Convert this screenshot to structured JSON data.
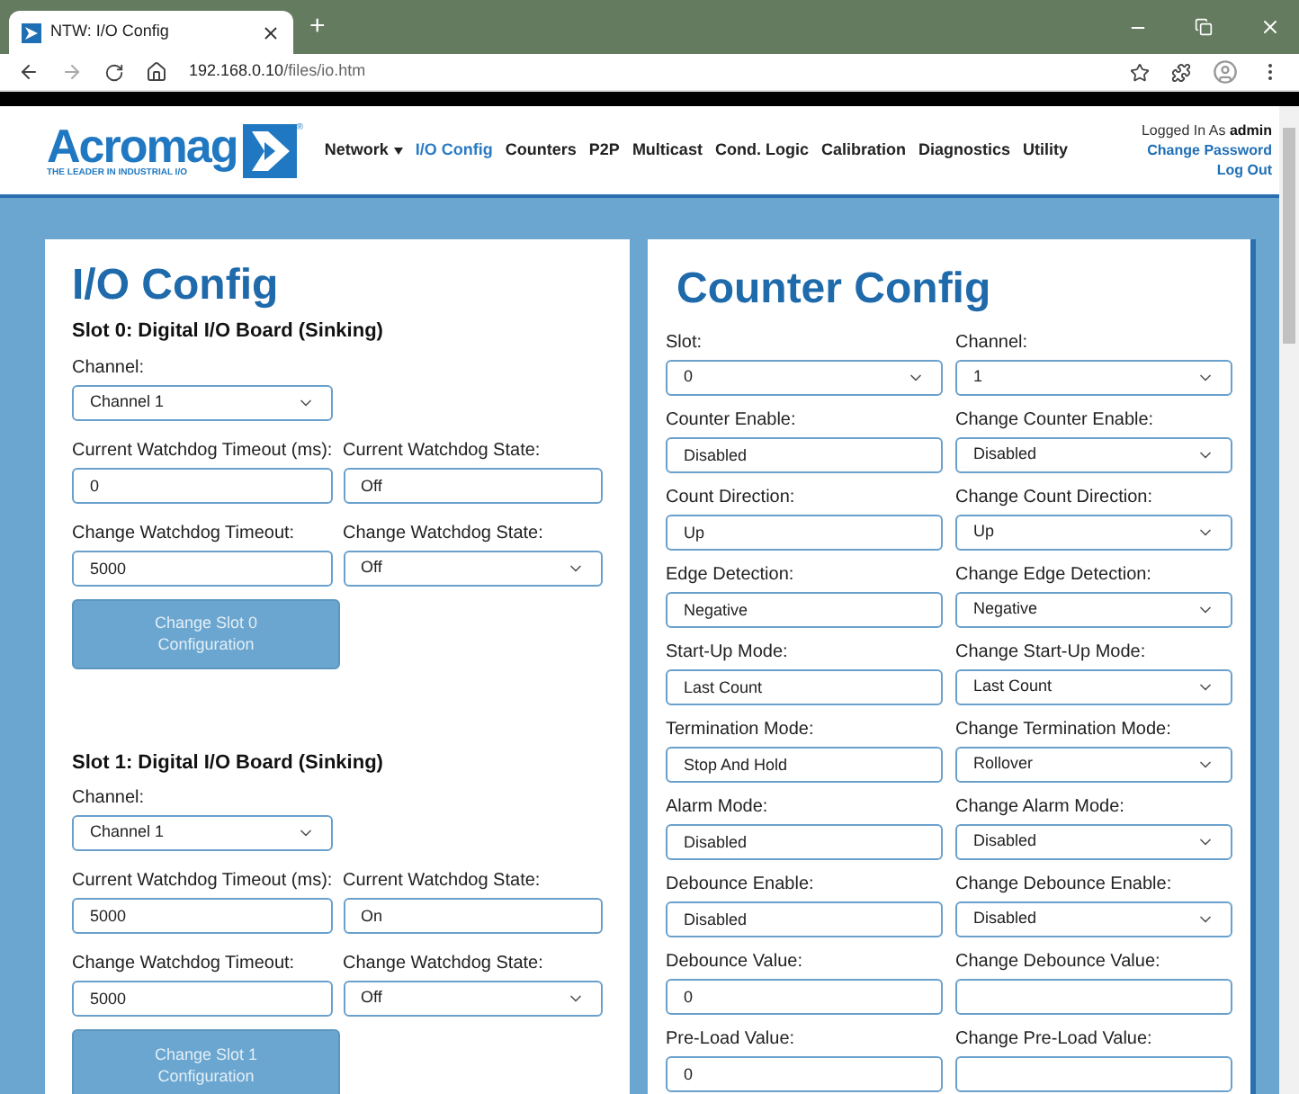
{
  "browser": {
    "tab_title": "NTW: I/O Config",
    "new_tab": "+",
    "url_host": "192.168.0.10",
    "url_path": "/files/io.htm"
  },
  "header": {
    "logo": "Acromag",
    "tagline": "THE LEADER IN INDUSTRIAL I/O",
    "mark": "®",
    "nav": [
      {
        "label": "Network",
        "selected": false,
        "dropdown": true
      },
      {
        "label": "I/O Config",
        "selected": true,
        "dropdown": false
      },
      {
        "label": "Counters",
        "selected": false,
        "dropdown": false
      },
      {
        "label": "P2P",
        "selected": false,
        "dropdown": false
      },
      {
        "label": "Multicast",
        "selected": false,
        "dropdown": false
      },
      {
        "label": "Cond. Logic",
        "selected": false,
        "dropdown": false
      },
      {
        "label": "Calibration",
        "selected": false,
        "dropdown": false
      },
      {
        "label": "Diagnostics",
        "selected": false,
        "dropdown": false
      },
      {
        "label": "Utility",
        "selected": false,
        "dropdown": false
      }
    ],
    "logged_in_label": "Logged In As",
    "user": "admin",
    "links": [
      "Change Password",
      "Log Out"
    ]
  },
  "io_config": {
    "title": "I/O Config",
    "slots": [
      {
        "heading": "Slot 0: Digital I/O Board (Sinking)",
        "channel": {
          "label": "Channel:",
          "value": "Channel 1",
          "kind": "select"
        },
        "fields": [
          {
            "label": "Current Watchdog Timeout (ms):",
            "value": "0",
            "kind": "text"
          },
          {
            "label": "Current Watchdog State:",
            "value": "Off",
            "kind": "text"
          },
          {
            "label": "Change Watchdog Timeout:",
            "value": "5000",
            "kind": "text"
          },
          {
            "label": "Change Watchdog State:",
            "value": "Off",
            "kind": "select"
          }
        ],
        "button": "Change Slot 0 Configuration"
      },
      {
        "heading": "Slot 1: Digital I/O Board (Sinking)",
        "channel": {
          "label": "Channel:",
          "value": "Channel 1",
          "kind": "select"
        },
        "fields": [
          {
            "label": "Current Watchdog Timeout (ms):",
            "value": "5000",
            "kind": "text"
          },
          {
            "label": "Current Watchdog State:",
            "value": "On",
            "kind": "text"
          },
          {
            "label": "Change Watchdog Timeout:",
            "value": "5000",
            "kind": "text"
          },
          {
            "label": "Change Watchdog State:",
            "value": "Off",
            "kind": "select"
          }
        ],
        "button": "Change Slot 1 Configuration"
      }
    ]
  },
  "counter_config": {
    "title": "Counter Config",
    "fields": [
      {
        "label": "Slot:",
        "value": "0",
        "kind": "select"
      },
      {
        "label": "Channel:",
        "value": "1",
        "kind": "select"
      },
      {
        "label": "Counter Enable:",
        "value": "Disabled",
        "kind": "text"
      },
      {
        "label": "Change Counter Enable:",
        "value": "Disabled",
        "kind": "select"
      },
      {
        "label": "Count Direction:",
        "value": "Up",
        "kind": "text"
      },
      {
        "label": "Change Count Direction:",
        "value": "Up",
        "kind": "select"
      },
      {
        "label": "Edge Detection:",
        "value": "Negative",
        "kind": "text"
      },
      {
        "label": "Change Edge Detection:",
        "value": "Negative",
        "kind": "select"
      },
      {
        "label": "Start-Up Mode:",
        "value": "Last Count",
        "kind": "text"
      },
      {
        "label": "Change Start-Up Mode:",
        "value": "Last Count",
        "kind": "select"
      },
      {
        "label": "Termination Mode:",
        "value": "Stop And Hold",
        "kind": "text"
      },
      {
        "label": "Change Termination Mode:",
        "value": "Rollover",
        "kind": "select"
      },
      {
        "label": "Alarm Mode:",
        "value": "Disabled",
        "kind": "text"
      },
      {
        "label": "Change Alarm Mode:",
        "value": "Disabled",
        "kind": "select"
      },
      {
        "label": "Debounce Enable:",
        "value": "Disabled",
        "kind": "text"
      },
      {
        "label": "Change Debounce Enable:",
        "value": "Disabled",
        "kind": "select"
      },
      {
        "label": "Debounce Value:",
        "value": "0",
        "kind": "text"
      },
      {
        "label": "Change Debounce Value:",
        "kind": "text"
      },
      {
        "label": "Pre-Load Value:",
        "value": "0",
        "kind": "text"
      },
      {
        "label": "Change Pre-Load Value:",
        "kind": "text"
      }
    ]
  }
}
